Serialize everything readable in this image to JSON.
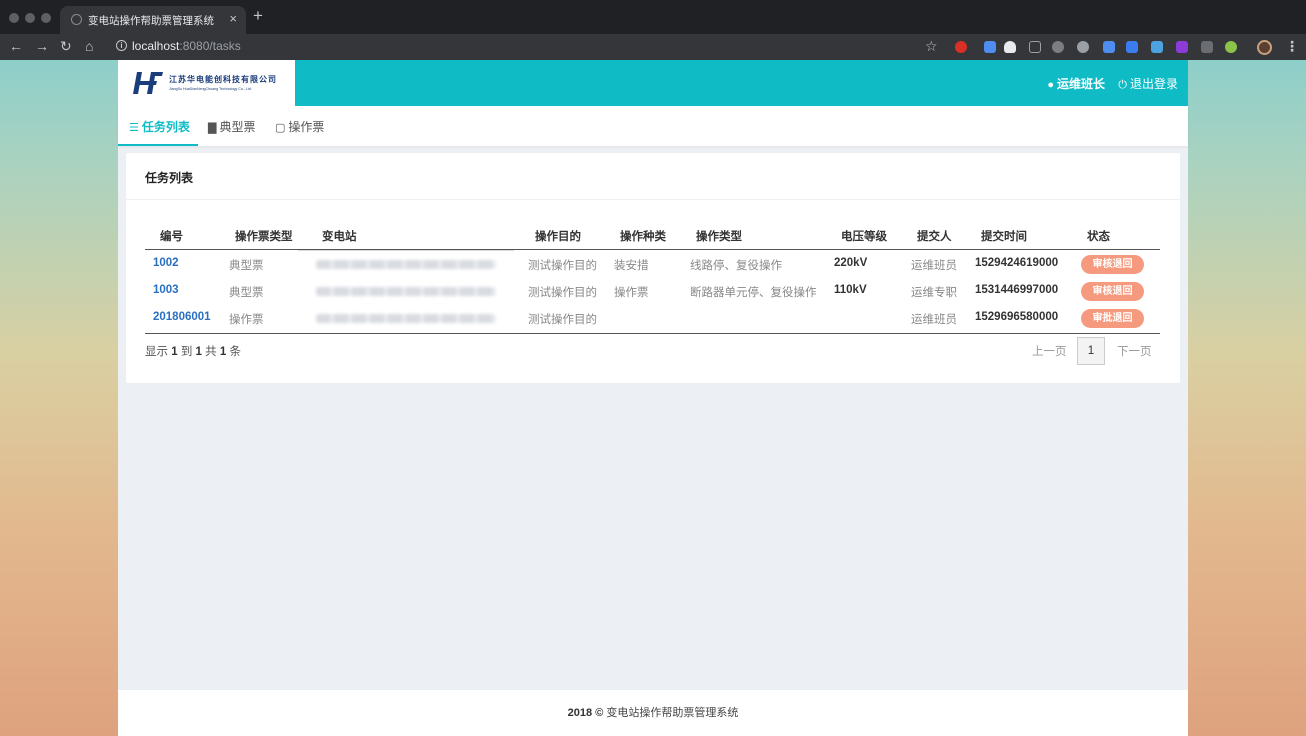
{
  "browser": {
    "tab_title": "变电站操作帮助票管理系统",
    "url_host": "localhost",
    "url_rest": ":8080/tasks"
  },
  "app": {
    "logo_cn": "江苏华电能创科技有限公司",
    "logo_en": "JiangSu HuaDianNengChuang Technology Co., Ltd.",
    "user": "运维班长",
    "logout": "退出登录",
    "nav": [
      {
        "label": "任务列表",
        "icon": "list-icon",
        "active": true
      },
      {
        "label": "典型票",
        "icon": "file-icon",
        "active": false
      },
      {
        "label": "操作票",
        "icon": "file-outline-icon",
        "active": false
      }
    ]
  },
  "card": {
    "title": "任务列表"
  },
  "table": {
    "headers": [
      "编号",
      "操作票类型",
      "变电站",
      "操作目的",
      "操作种类",
      "操作类型",
      "电压等级",
      "提交人",
      "提交时间",
      "状态"
    ],
    "rows": [
      {
        "id": "1002",
        "ticket_type": "典型票",
        "station": "",
        "purpose": "测试操作目的",
        "kind": "装安措",
        "op_type": "线路停、复役操作",
        "voltage": "220kV",
        "submitter": "运维班员",
        "time": "1529424619000",
        "status": "审核退回"
      },
      {
        "id": "1003",
        "ticket_type": "典型票",
        "station": "",
        "purpose": "测试操作目的",
        "kind": "操作票",
        "op_type": "断路器单元停、复役操作",
        "voltage": "110kV",
        "submitter": "运维专职",
        "time": "1531446997000",
        "status": "审核退回"
      },
      {
        "id": "201806001",
        "ticket_type": "操作票",
        "station": "",
        "purpose": "测试操作目的",
        "kind": "",
        "op_type": "",
        "voltage": "",
        "submitter": "运维班员",
        "time": "1529696580000",
        "status": "审批退回"
      }
    ]
  },
  "pagination": {
    "info_prefix": "显示",
    "from": "1",
    "to_word": "到",
    "to": "1",
    "total_word": "共",
    "total": "1",
    "unit": "条",
    "prev": "上一页",
    "page": "1",
    "next": "下一页"
  },
  "footer": {
    "year": "2018",
    "copyright": "©",
    "text": "变电站操作帮助票管理系统"
  },
  "colors": {
    "accent": "#0fbcc6",
    "badge": "#f59a7e",
    "link": "#2a6fc2"
  }
}
